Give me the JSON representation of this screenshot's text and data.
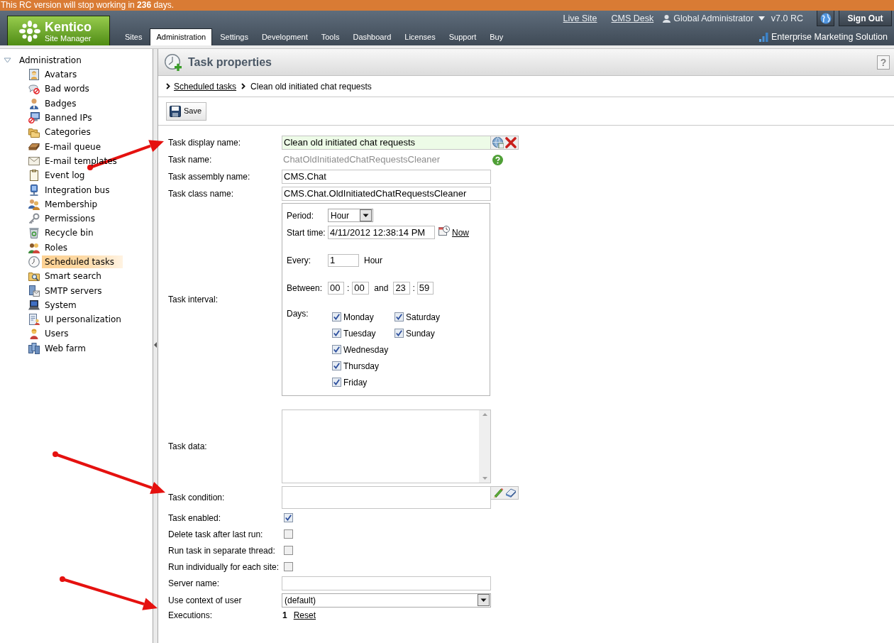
{
  "banner": {
    "text": "This RC version will stop working in **236** days."
  },
  "header": {
    "logo": {
      "title": "Kentico",
      "subtitle": "Site Manager"
    },
    "tabs": [
      {
        "label": "Sites",
        "selected": false
      },
      {
        "label": "Administration",
        "selected": true
      },
      {
        "label": "Settings",
        "selected": false
      },
      {
        "label": "Development",
        "selected": false
      },
      {
        "label": "Tools",
        "selected": false
      },
      {
        "label": "Dashboard",
        "selected": false
      },
      {
        "label": "Licenses",
        "selected": false
      },
      {
        "label": "Support",
        "selected": false
      },
      {
        "label": "Buy",
        "selected": false
      }
    ],
    "links": [
      "Live Site",
      "CMS Desk"
    ],
    "user": "Global Administrator",
    "version": "v7.0 RC",
    "sign_out": "Sign Out",
    "edition": "Enterprise Marketing Solution"
  },
  "sidebar": {
    "root": {
      "label": "Administration",
      "expanded": true,
      "children": [
        {
          "label": "Avatars",
          "selected": false
        },
        {
          "label": "Bad words",
          "selected": false
        },
        {
          "label": "Badges",
          "selected": false
        },
        {
          "label": "Banned IPs",
          "selected": false
        },
        {
          "label": "Categories",
          "selected": false
        },
        {
          "label": "E-mail queue",
          "selected": false
        },
        {
          "label": "E-mail templates",
          "selected": false
        },
        {
          "label": "Event log",
          "selected": false
        },
        {
          "label": "Integration bus",
          "selected": false
        },
        {
          "label": "Membership",
          "selected": false
        },
        {
          "label": "Permissions",
          "selected": false
        },
        {
          "label": "Recycle bin",
          "selected": false
        },
        {
          "label": "Roles",
          "selected": false
        },
        {
          "label": "Scheduled tasks",
          "selected": true
        },
        {
          "label": "Smart search",
          "selected": false
        },
        {
          "label": "SMTP servers",
          "selected": false
        },
        {
          "label": "System",
          "selected": false
        },
        {
          "label": "UI personalization",
          "selected": false
        },
        {
          "label": "Users",
          "selected": false
        },
        {
          "label": "Web farm",
          "selected": false
        }
      ]
    }
  },
  "panel": {
    "title": "Task properties",
    "help": "?",
    "breadcrumb": [
      {
        "label": "Scheduled tasks",
        "kind": "link"
      },
      {
        "label": "Clean old initiated chat requests",
        "kind": "current"
      }
    ],
    "save": "Save",
    "form": [
      {
        "kind": "localized",
        "label": "Task display name:",
        "value": "Clean old initiated chat requests"
      },
      {
        "kind": "readonly",
        "label": "Task name:",
        "value": "ChatOldInitiatedChatRequestsCleaner"
      },
      {
        "kind": "text",
        "label": "Task assembly name:",
        "value": "CMS.Chat"
      },
      {
        "kind": "text",
        "label": "Task class name:",
        "value": "CMS.Chat.OldInitiatedChatRequestsCleaner"
      },
      {
        "kind": "interval",
        "label": "Task interval:",
        "period": {
          "label": "Period:",
          "value": "Hour"
        },
        "start_time": {
          "label": "Start time:",
          "value": "4/11/2012 12:38:14 PM",
          "now": "Now"
        },
        "every": {
          "label": "Every:",
          "value": "1",
          "unit": "Hour"
        },
        "between": {
          "label": "Between:",
          "from_hour": "00",
          "separator_1": ":",
          "from_minute": "00",
          "conjunction": "and",
          "to_hour": "23",
          "separator_2": ":",
          "to_minute": "59"
        },
        "days": {
          "label": "Days:",
          "items": [
            {
              "label": "Monday",
              "checked": true
            },
            {
              "label": "Tuesday",
              "checked": true
            },
            {
              "label": "Wednesday",
              "checked": true
            },
            {
              "label": "Thursday",
              "checked": true
            },
            {
              "label": "Friday",
              "checked": true
            },
            {
              "label": "Saturday",
              "checked": true
            },
            {
              "label": "Sunday",
              "checked": true
            }
          ]
        }
      },
      {
        "kind": "textarea",
        "label": "Task data:"
      },
      {
        "kind": "condition",
        "label": "Task condition:"
      },
      {
        "kind": "checkbox",
        "label": "Task enabled:",
        "checked": true
      },
      {
        "kind": "checkbox",
        "label": "Delete task after last run:",
        "checked": false
      },
      {
        "kind": "checkbox",
        "label": "Run task in separate thread:",
        "checked": false
      },
      {
        "kind": "checkbox",
        "label": "Run individually for each site:",
        "checked": false
      },
      {
        "kind": "text",
        "label": "Server name:"
      },
      {
        "kind": "select",
        "label": "Use context of user",
        "value": "(default)"
      },
      {
        "kind": "executions",
        "label": "Executions:",
        "value": "1",
        "action": "Reset"
      }
    ]
  }
}
